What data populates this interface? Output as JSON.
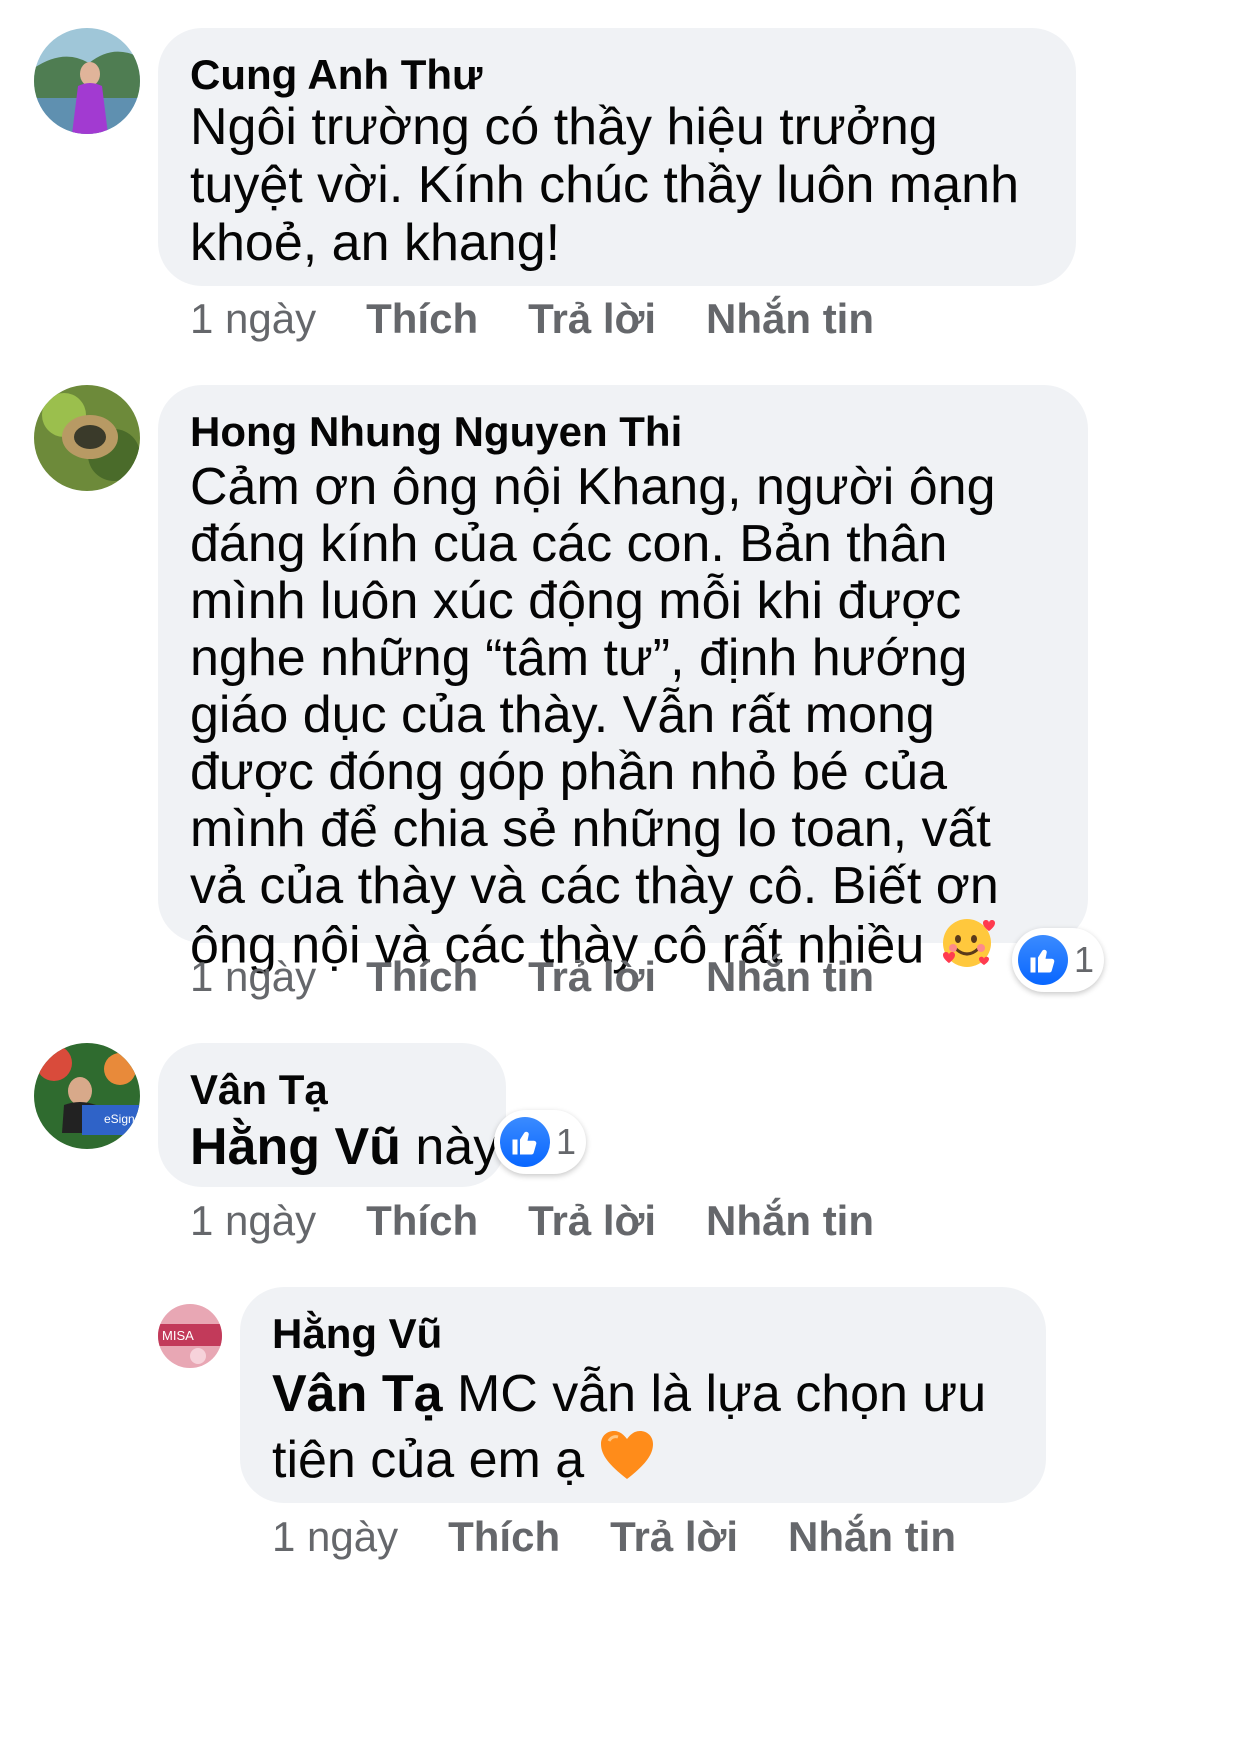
{
  "comments": [
    {
      "author": "Cung Anh Thư",
      "text": "Ngôi trường có thầy hiệu trưởng tuyệt vời. Kính chúc thầy luôn mạnh khoẻ, an khang!",
      "time": "1 ngày",
      "like": "Thích",
      "reply": "Trả lời",
      "message": "Nhắn tin"
    },
    {
      "author": "Hong Nhung Nguyen Thi",
      "text": "Cảm ơn ông nội Khang, người ông đáng kính của các con. Bản thân mình luôn xúc động mỗi khi được nghe những “tâm tư”, định hướng giáo dục của thày. Vẫn rất mong được đóng góp phần nhỏ bé của mình để chia sẻ những lo toan, vất vả của thày và các thày cô. Biết ơn ông nội và các thày cô rất nhiều",
      "emoji": "smiling-face-with-hearts",
      "reactions": "1",
      "time": "1 ngày",
      "like": "Thích",
      "reply": "Trả lời",
      "message": "Nhắn tin"
    },
    {
      "author": "Vân Tạ",
      "mention": "Hằng Vũ",
      "text": " này",
      "reactions": "1",
      "time": "1 ngày",
      "like": "Thích",
      "reply": "Trả lời",
      "message": "Nhắn tin"
    },
    {
      "author": "Hằng Vũ",
      "mention": "Vân Tạ",
      "text": " MC vẫn là lựa chọn ưu tiên của em ạ",
      "emoji": "orange-heart",
      "time": "1 ngày",
      "like": "Thích",
      "reply": "Trả lời",
      "message": "Nhắn tin"
    }
  ],
  "colors": {
    "bubble": "#f0f2f5",
    "meta": "#65676b",
    "like_blue": "#0866ff"
  }
}
